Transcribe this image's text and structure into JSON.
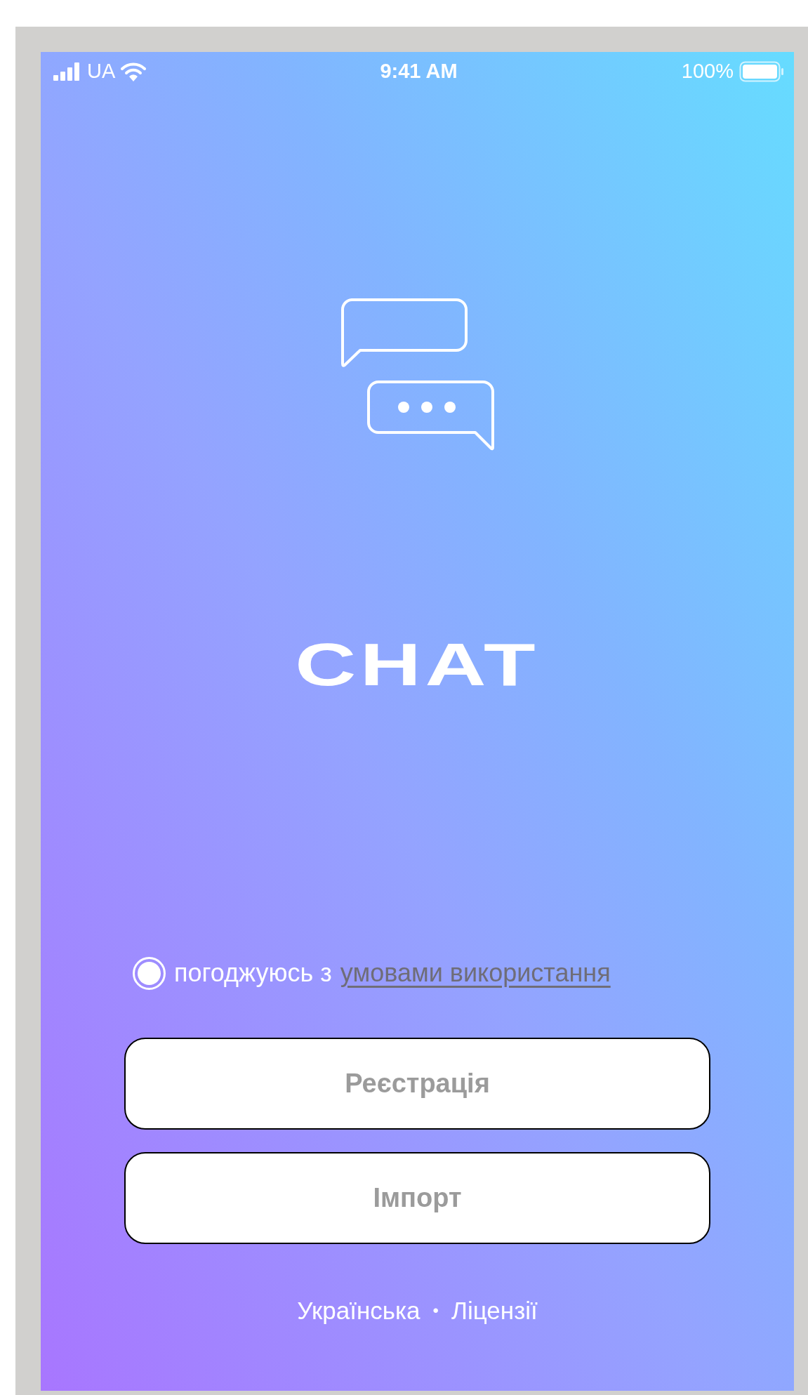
{
  "status_bar": {
    "carrier": "UA",
    "time": "9:41 AM",
    "battery": "100%"
  },
  "logo": {
    "title": "CHAT"
  },
  "terms": {
    "checked": true,
    "text": "погоджуюсь з",
    "link": "умовами використання"
  },
  "buttons": [
    {
      "label": "Реєстрація"
    },
    {
      "label": "Імпорт"
    }
  ],
  "footer": {
    "links": [
      "Українська",
      "Ліцензії"
    ],
    "separator": "•"
  }
}
